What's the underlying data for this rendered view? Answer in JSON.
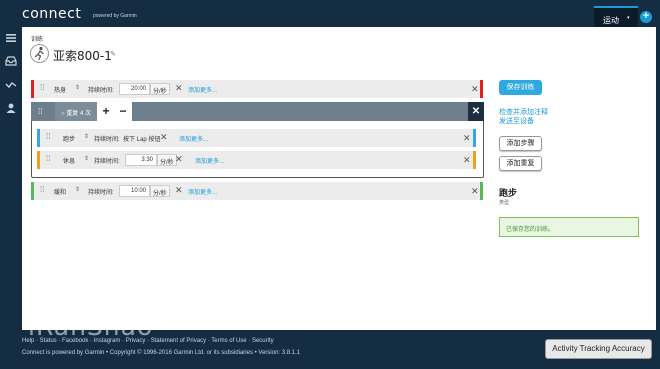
{
  "header": {
    "logo": "connect",
    "logo_sub": "powered by Garmin",
    "sport_tab": "运动",
    "caret": "▾",
    "plus": "+"
  },
  "rail": {
    "icons": [
      "menu-icon",
      "inbox-icon",
      "chart-icon",
      "person-icon"
    ]
  },
  "page": {
    "breadcrumb": "训练",
    "workout_name": "亚索800-1",
    "pencil": "✎"
  },
  "steps": {
    "warmup": {
      "type": "热身",
      "duration_label": "持续时间:",
      "time": "20:00",
      "unit": "分/秒",
      "add_more": "添加更多...",
      "color": "#e02020"
    },
    "repeat": {
      "label": "重复 4 次",
      "plus": "+",
      "minus": "−",
      "close": "✕"
    },
    "run": {
      "type": "跑步",
      "duration_label": "持续时间:",
      "value": "按下 Lap 按钮",
      "add_more": "添加更多...",
      "color": "#2fa9e0"
    },
    "rest": {
      "type": "休息",
      "duration_label": "持续时间:",
      "time": "3:30",
      "unit": "分/秒",
      "add_more": "添加更多...",
      "color": "#f0a020"
    },
    "cooldown": {
      "type": "缓和",
      "duration_label": "持续时间:",
      "time": "10:00",
      "unit": "分/秒",
      "add_more": "添加更多...",
      "color": "#5cb85c"
    }
  },
  "sidebar_right": {
    "save_button": "保存训练",
    "link_notes": "检查并添加注释",
    "link_send": "发送至设备",
    "add_step": "添加步骤",
    "add_repeat": "添加重复",
    "sport_title": "跑步",
    "sport_sub": "类型",
    "saved_message": "已保存您的训练。"
  },
  "footer": {
    "line1": "Help · Status · Facebook · Instagram · Privacy · Statement of Privacy · Terms of Use · Security",
    "line2": "Connect is powered by Garmin • Copyright © 1996-2016 Garmin Ltd. or its subsidiaries • Version: 3.8.1.1",
    "accuracy_button": "Activity Tracking Accuracy",
    "watermark": "iRanShao"
  }
}
